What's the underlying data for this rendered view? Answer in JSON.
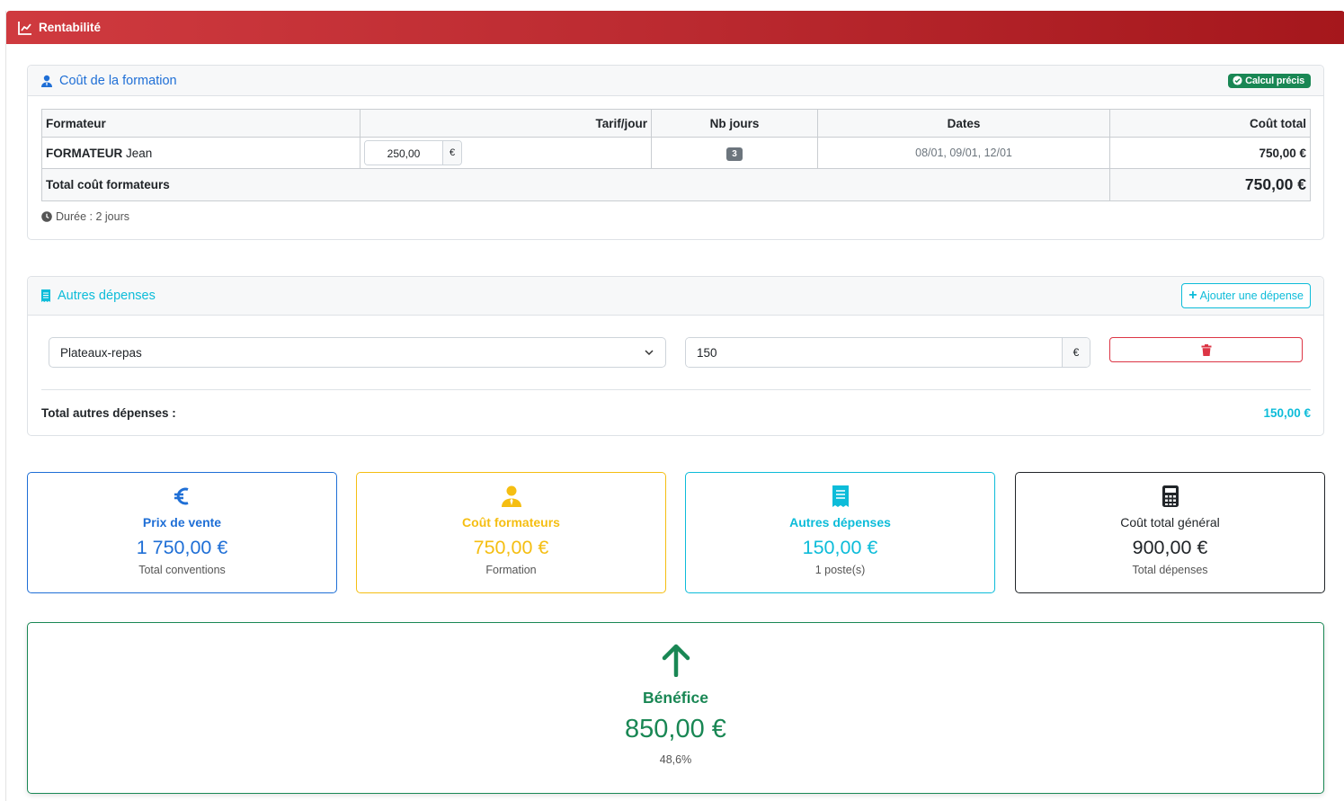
{
  "header": {
    "title": "Rentabilité",
    "icon": "line-chart-icon"
  },
  "formation_card": {
    "title": "Coût de la formation",
    "badge": "Calcul précis",
    "table": {
      "columns": [
        "Formateur",
        "Tarif/jour",
        "Nb jours",
        "Dates",
        "Coût total"
      ],
      "rows": [
        {
          "name_bold": "FORMATEUR",
          "name_rest": " Jean",
          "rate": "250,00",
          "currency": "€",
          "days": "3",
          "dates": "08/01, 09/01, 12/01",
          "total": "750,00 €"
        }
      ],
      "total_label": "Total coût formateurs",
      "total_value": "750,00 €"
    },
    "duration": "Durée : 2 jours"
  },
  "expenses_card": {
    "title": "Autres dépenses",
    "add_label": "Ajouter une dépense",
    "items": [
      {
        "category": "Plateaux-repas",
        "amount": "150",
        "currency": "€"
      }
    ],
    "total_label": "Total autres dépenses :",
    "total_value": "150,00 €"
  },
  "stats": [
    {
      "label": "Prix de vente",
      "value": "1 750,00 €",
      "sub": "Total conventions",
      "icon": "euro-icon",
      "color": "#1f6fd6"
    },
    {
      "label": "Coût formateurs",
      "value": "750,00 €",
      "sub": "Formation",
      "icon": "user-tie-icon",
      "color": "#f5be12"
    },
    {
      "label": "Autres dépenses",
      "value": "150,00 €",
      "sub": "1 poste(s)",
      "icon": "receipt-icon",
      "color": "#0dbcd9"
    },
    {
      "label": "Coût total général",
      "value": "900,00 €",
      "sub": "Total dépenses",
      "icon": "calculator-icon",
      "color": "#212529"
    }
  ],
  "profit": {
    "label": "Bénéfice",
    "value": "850,00 €",
    "percent": "48,6%",
    "icon": "arrow-up-icon",
    "color": "#198754"
  }
}
